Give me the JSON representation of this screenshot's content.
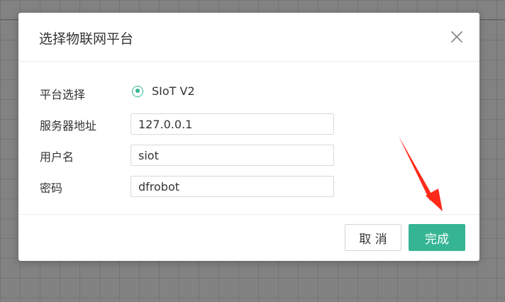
{
  "dialog": {
    "title": "选择物联网平台",
    "close_icon": "close-icon"
  },
  "form": {
    "platform": {
      "label": "平台选择",
      "selected_option": "SIoT V2",
      "selected": true
    },
    "server": {
      "label": "服务器地址",
      "value": "127.0.0.1"
    },
    "username": {
      "label": "用户名",
      "value": "siot"
    },
    "password": {
      "label": "密码",
      "value": "dfrobot"
    }
  },
  "footer": {
    "cancel_label": "取 消",
    "confirm_label": "完成"
  },
  "colors": {
    "accent": "#36b594",
    "overlay": "#828282",
    "annotation_arrow": "#ff2a1a"
  }
}
